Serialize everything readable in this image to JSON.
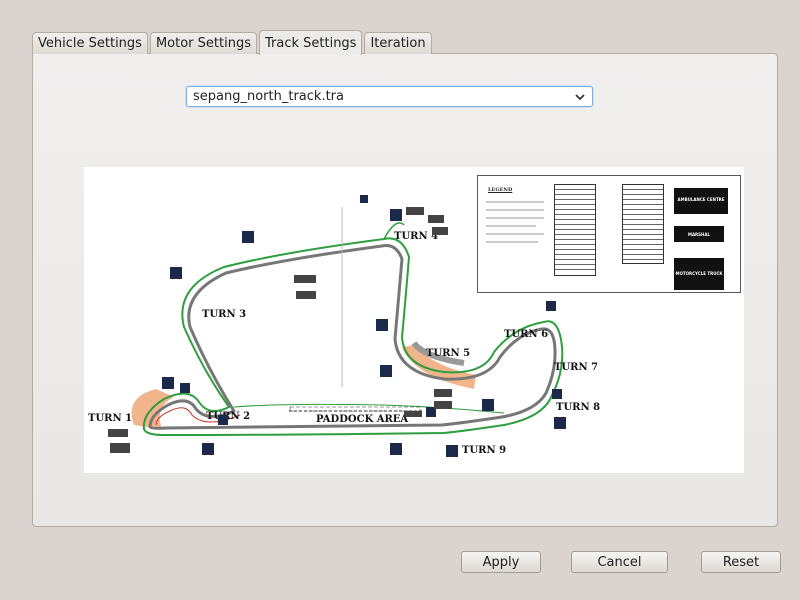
{
  "tabs": [
    {
      "label": "Vehicle Settings",
      "mnemonic": "V",
      "active": false
    },
    {
      "label": "Motor Settings",
      "mnemonic": "M",
      "active": false
    },
    {
      "label": "Track Settings",
      "mnemonic": "T",
      "active": true
    },
    {
      "label": "Iteration",
      "mnemonic": "I",
      "active": false
    }
  ],
  "track_select": {
    "value": "sepang_north_track.tra"
  },
  "map": {
    "turn_labels": [
      "TURN 1",
      "TURN 2",
      "TURN 3",
      "TURN 4",
      "TURN 5",
      "TURN 6",
      "TURN 7",
      "TURN 8",
      "TURN 9"
    ],
    "paddock_label": "PADDOCK AREA",
    "legend_title": "LEGEND",
    "legend_icons": [
      "AMBULANCE CENTRE",
      "MARSHAL",
      "MOTORCYCLE TRUCK"
    ]
  },
  "buttons": {
    "apply": {
      "label": "Apply",
      "mnemonic": "A"
    },
    "cancel": {
      "label": "Cancel",
      "mnemonic": "C"
    },
    "reset": {
      "label": "Reset",
      "mnemonic": "R"
    }
  },
  "colors": {
    "accent": "#7eaedb",
    "track_green": "#2e9e3e",
    "runoff": "#f2b48a"
  }
}
